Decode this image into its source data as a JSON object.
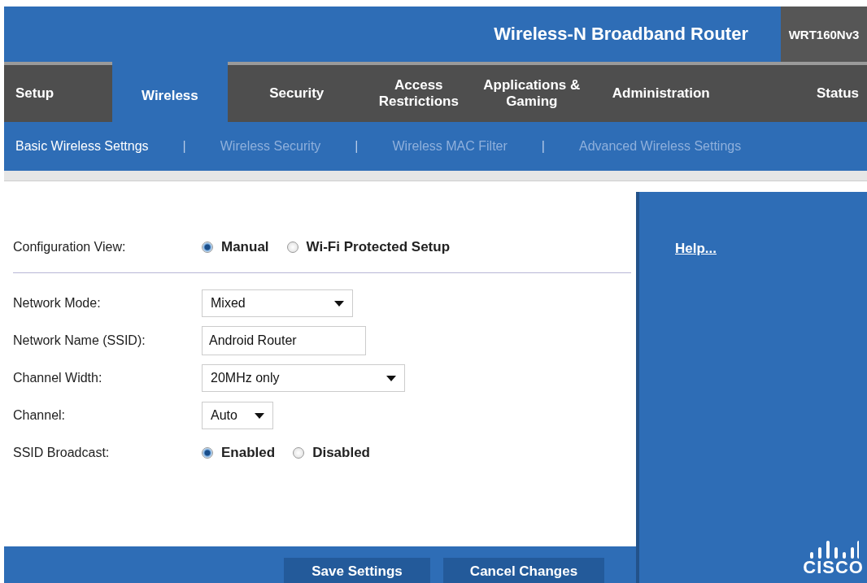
{
  "header": {
    "title": "Wireless-N Broadband Router",
    "model": "WRT160Nv3"
  },
  "tabs": [
    {
      "label": "Setup",
      "selected": false
    },
    {
      "label": "Wireless",
      "selected": true
    },
    {
      "label": "Security",
      "selected": false
    },
    {
      "label": "Access Restrictions",
      "selected": false
    },
    {
      "label": "Applications & Gaming",
      "selected": false
    },
    {
      "label": "Administration",
      "selected": false
    },
    {
      "label": "Status",
      "selected": false
    }
  ],
  "subnav": [
    {
      "kind": "link",
      "label": "Basic Wireless Settngs",
      "selected": true
    },
    {
      "kind": "separator",
      "label": "|"
    },
    {
      "kind": "link",
      "label": "Wireless Security",
      "selected": false
    },
    {
      "kind": "separator",
      "label": "|"
    },
    {
      "kind": "link",
      "label": "Wireless MAC Filter",
      "selected": false
    },
    {
      "kind": "separator",
      "label": "|"
    },
    {
      "kind": "link",
      "label": "Advanced Wireless Settings",
      "selected": false
    }
  ],
  "config_view": {
    "label": "Configuration View:",
    "options": [
      {
        "label": "Manual",
        "selected": true
      },
      {
        "label": "Wi-Fi Protected Setup",
        "selected": false
      }
    ]
  },
  "fields": [
    {
      "kind": "select",
      "label": "Network Mode:",
      "value": "Mixed"
    },
    {
      "kind": "text",
      "label": "Network Name (SSID):",
      "value": "Android Router"
    },
    {
      "kind": "select",
      "label": "Channel Width:",
      "value": "20MHz only"
    },
    {
      "kind": "select",
      "label": "Channel:",
      "value": "Auto"
    },
    {
      "kind": "radio",
      "label": "SSID Broadcast:",
      "options": [
        {
          "label": "Enabled",
          "selected": true
        },
        {
          "label": "Disabled",
          "selected": false
        }
      ]
    }
  ],
  "buttons": [
    "Save Settings",
    "Cancel Changes"
  ],
  "help_link": "Help...",
  "logo": "CISCO"
}
